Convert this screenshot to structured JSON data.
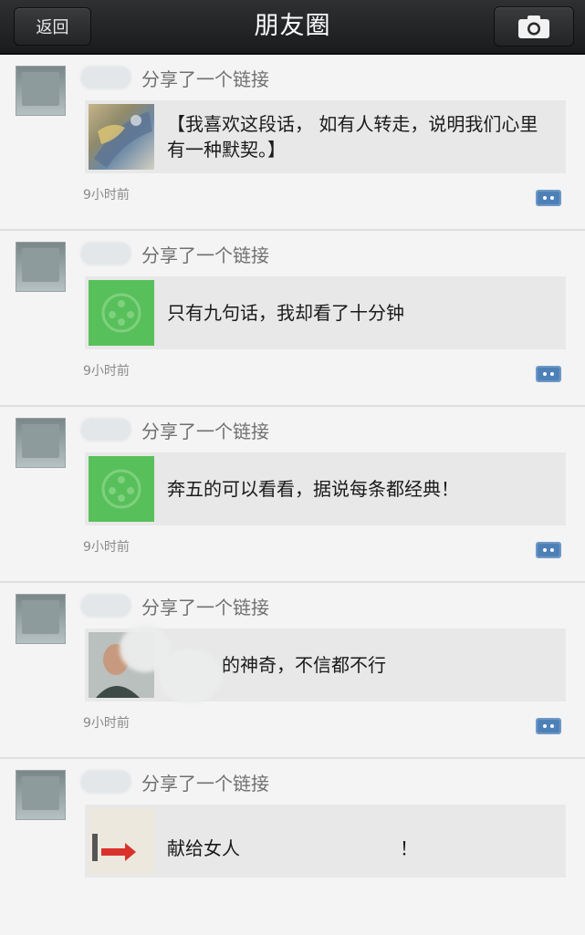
{
  "header": {
    "back_label": "返回",
    "title": "朋友圈",
    "camera_icon": "camera-icon"
  },
  "posts": [
    {
      "action": "分享了一个链接",
      "link_text": "【我喜欢这段话， 如有人转走，说明我们心里有一种默契。】",
      "time": "9小时前",
      "thumb": "art"
    },
    {
      "action": "分享了一个链接",
      "link_text": "只有九句话，我却看了十分钟",
      "time": "9小时前",
      "thumb": "green"
    },
    {
      "action": "分享了一个链接",
      "link_text": "奔五的可以看看，据说每条都经典！",
      "time": "9小时前",
      "thumb": "green"
    },
    {
      "action": "分享了一个链接",
      "link_text": "的神奇，不信都不行",
      "time": "9小时前",
      "thumb": "person"
    },
    {
      "action": "分享了一个链接",
      "link_text": "献给女人",
      "link_text_tail": "！",
      "time": "",
      "thumb": "sign"
    }
  ],
  "colors": {
    "header_bg": "#1f2021",
    "thumb_green": "#58c05a",
    "card_bg": "#e8e8e8",
    "comment_icon": "#5b8fc4"
  }
}
